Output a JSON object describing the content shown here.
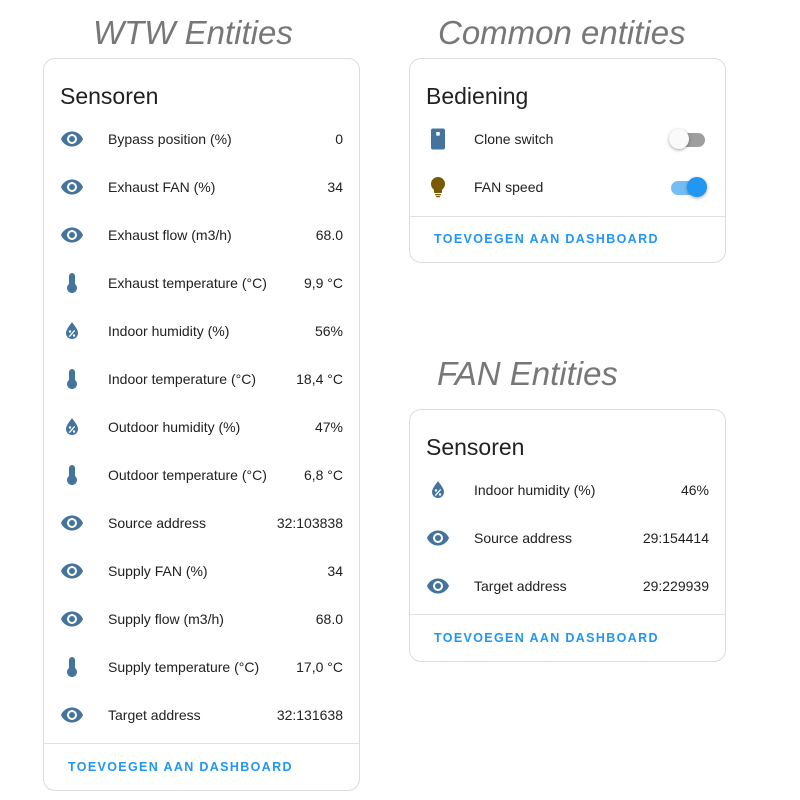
{
  "colors": {
    "icon": "#44739e",
    "bulb": "#7a5a00",
    "accent": "#2196f3",
    "section_title": "#777777"
  },
  "wtw": {
    "section_title": "WTW Entities",
    "card_title": "Sensoren",
    "rows": [
      {
        "icon": "eye-icon",
        "name": "Bypass position (%)",
        "value": "0"
      },
      {
        "icon": "eye-icon",
        "name": "Exhaust FAN (%)",
        "value": "34"
      },
      {
        "icon": "eye-icon",
        "name": "Exhaust flow (m3/h)",
        "value": "68.0"
      },
      {
        "icon": "thermometer-icon",
        "name": "Exhaust temperature (°C)",
        "value": "9,9 °C"
      },
      {
        "icon": "humidity-icon",
        "name": "Indoor humidity (%)",
        "value": "56%"
      },
      {
        "icon": "thermometer-icon",
        "name": "Indoor temperature (°C)",
        "value": "18,4 °C"
      },
      {
        "icon": "humidity-icon",
        "name": "Outdoor humidity (%)",
        "value": "47%"
      },
      {
        "icon": "thermometer-icon",
        "name": "Outdoor temperature (°C)",
        "value": "6,8 °C"
      },
      {
        "icon": "eye-icon",
        "name": "Source address",
        "value": "32:103838"
      },
      {
        "icon": "eye-icon",
        "name": "Supply FAN (%)",
        "value": "34"
      },
      {
        "icon": "eye-icon",
        "name": "Supply flow (m3/h)",
        "value": "68.0"
      },
      {
        "icon": "thermometer-icon",
        "name": "Supply temperature (°C)",
        "value": "17,0 °C"
      },
      {
        "icon": "eye-icon",
        "name": "Target address",
        "value": "32:131638"
      }
    ],
    "action_label": "TOEVOEGEN AAN DASHBOARD"
  },
  "common": {
    "section_title": "Common entities",
    "card_title": "Bediening",
    "rows": [
      {
        "icon": "remote-icon",
        "name": "Clone switch",
        "state": "off"
      },
      {
        "icon": "lightbulb-icon",
        "name": "FAN speed",
        "state": "on"
      }
    ],
    "action_label": "TOEVOEGEN AAN DASHBOARD"
  },
  "fan": {
    "section_title": "FAN Entities",
    "card_title": "Sensoren",
    "rows": [
      {
        "icon": "humidity-icon",
        "name": "Indoor humidity (%)",
        "value": "46%"
      },
      {
        "icon": "eye-icon",
        "name": "Source address",
        "value": "29:154414"
      },
      {
        "icon": "eye-icon",
        "name": "Target address",
        "value": "29:229939"
      }
    ],
    "action_label": "TOEVOEGEN AAN DASHBOARD"
  }
}
